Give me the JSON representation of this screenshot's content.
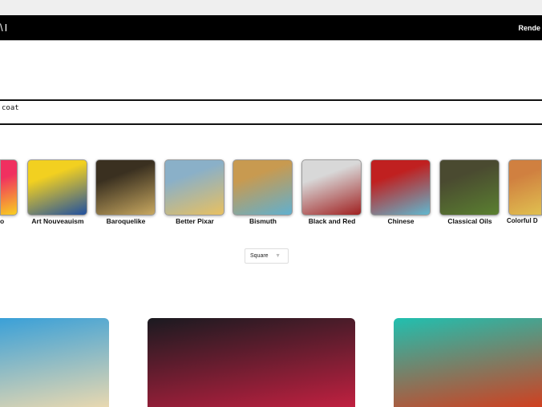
{
  "header": {
    "logo": "\\I",
    "nav_link": "Rende"
  },
  "prompt": {
    "value": "coat"
  },
  "styles": [
    {
      "label": "o",
      "colors": [
        "#f03060",
        "#f8d020"
      ]
    },
    {
      "label": "Art Nouveauism",
      "colors": [
        "#f2d020",
        "#2050a0"
      ]
    },
    {
      "label": "Baroquelike",
      "colors": [
        "#3a3020",
        "#c8a860"
      ]
    },
    {
      "label": "Better Pixar",
      "colors": [
        "#8ab0c8",
        "#e8c060"
      ]
    },
    {
      "label": "Bismuth",
      "colors": [
        "#c89a50",
        "#60b0d0"
      ]
    },
    {
      "label": "Black and Red",
      "colors": [
        "#d8d8d8",
        "#a02020"
      ]
    },
    {
      "label": "Chinese",
      "colors": [
        "#c02020",
        "#60b8d0"
      ]
    },
    {
      "label": "Classical Oils",
      "colors": [
        "#4a4a30",
        "#5a8030"
      ]
    },
    {
      "label": "Colorful D",
      "colors": [
        "#d08040",
        "#e0c050"
      ]
    }
  ],
  "aspect_select": {
    "value": "Square"
  },
  "gallery": [
    {
      "colors": [
        "#3aa0d8",
        "#e8d8b0"
      ]
    },
    {
      "colors": [
        "#1a1a20",
        "#c02040"
      ]
    },
    {
      "colors": [
        "#20c0b0",
        "#d04020"
      ]
    }
  ]
}
